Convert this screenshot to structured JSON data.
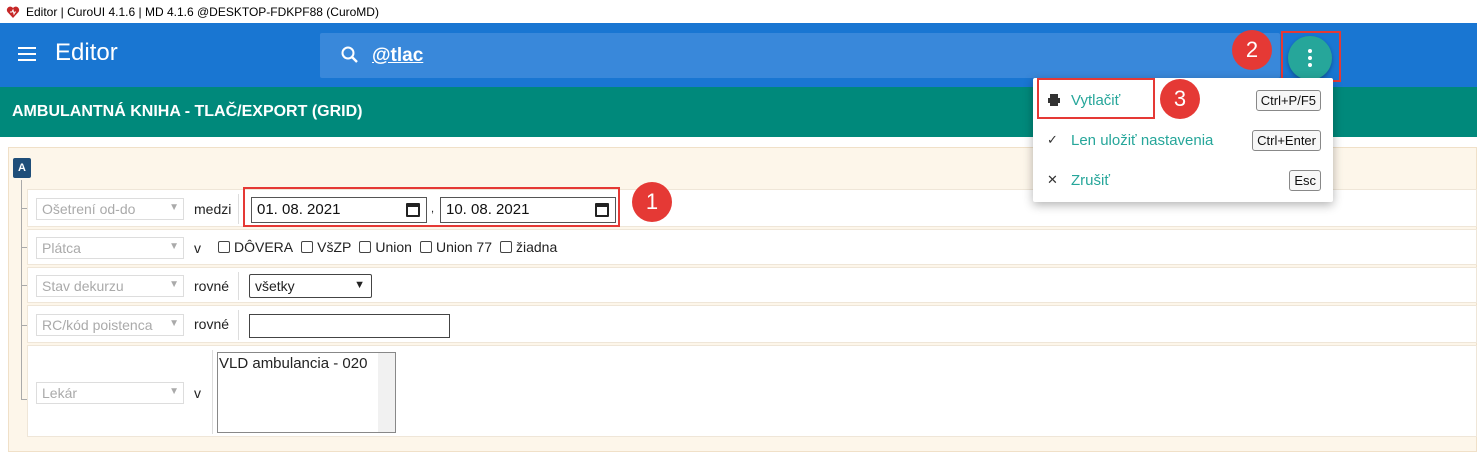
{
  "window": {
    "title": "Editor | CuroUI 4.1.6 | MD 4.1.6 @DESKTOP-FDKPF88 (CuroMD)"
  },
  "appbar": {
    "title": "Editor",
    "search_value": "@tlac"
  },
  "header": {
    "title": "AMBULANTNÁ KNIHA - TLAČ/EXPORT (GRID)"
  },
  "form": {
    "group_tag": "A",
    "rows": [
      {
        "field": "Ošetrení od-do",
        "operator": "medzi",
        "date_from": "01. 08. 2021",
        "separator": ",",
        "date_to": "10. 08. 2021"
      },
      {
        "field": "Plátca",
        "operator": "v",
        "options": [
          "DÔVERA",
          "VšZP",
          "Union",
          "Union 77",
          "žiadna"
        ]
      },
      {
        "field": "Stav dekurzu",
        "operator": "rovné",
        "selected": "všetky"
      },
      {
        "field": "RC/kód poistenca",
        "operator": "rovné",
        "value": ""
      },
      {
        "field": "Lekár",
        "operator": "v",
        "list_items": [
          "VLD ambulancia - 020"
        ]
      }
    ]
  },
  "menu": {
    "items": [
      {
        "label": "Vytlačiť",
        "shortcut": "Ctrl+P/F5",
        "icon": "printer-icon"
      },
      {
        "label": "Len uložiť nastavenia",
        "shortcut": "Ctrl+Enter",
        "icon": "check-icon"
      },
      {
        "label": "Zrušiť",
        "shortcut": "Esc",
        "icon": "close-icon"
      }
    ]
  },
  "annotations": [
    "1",
    "2",
    "3"
  ],
  "colors": {
    "appbar": "#1976d2",
    "header": "#00897b",
    "accent": "#26a69a",
    "annotation": "#e53935"
  }
}
